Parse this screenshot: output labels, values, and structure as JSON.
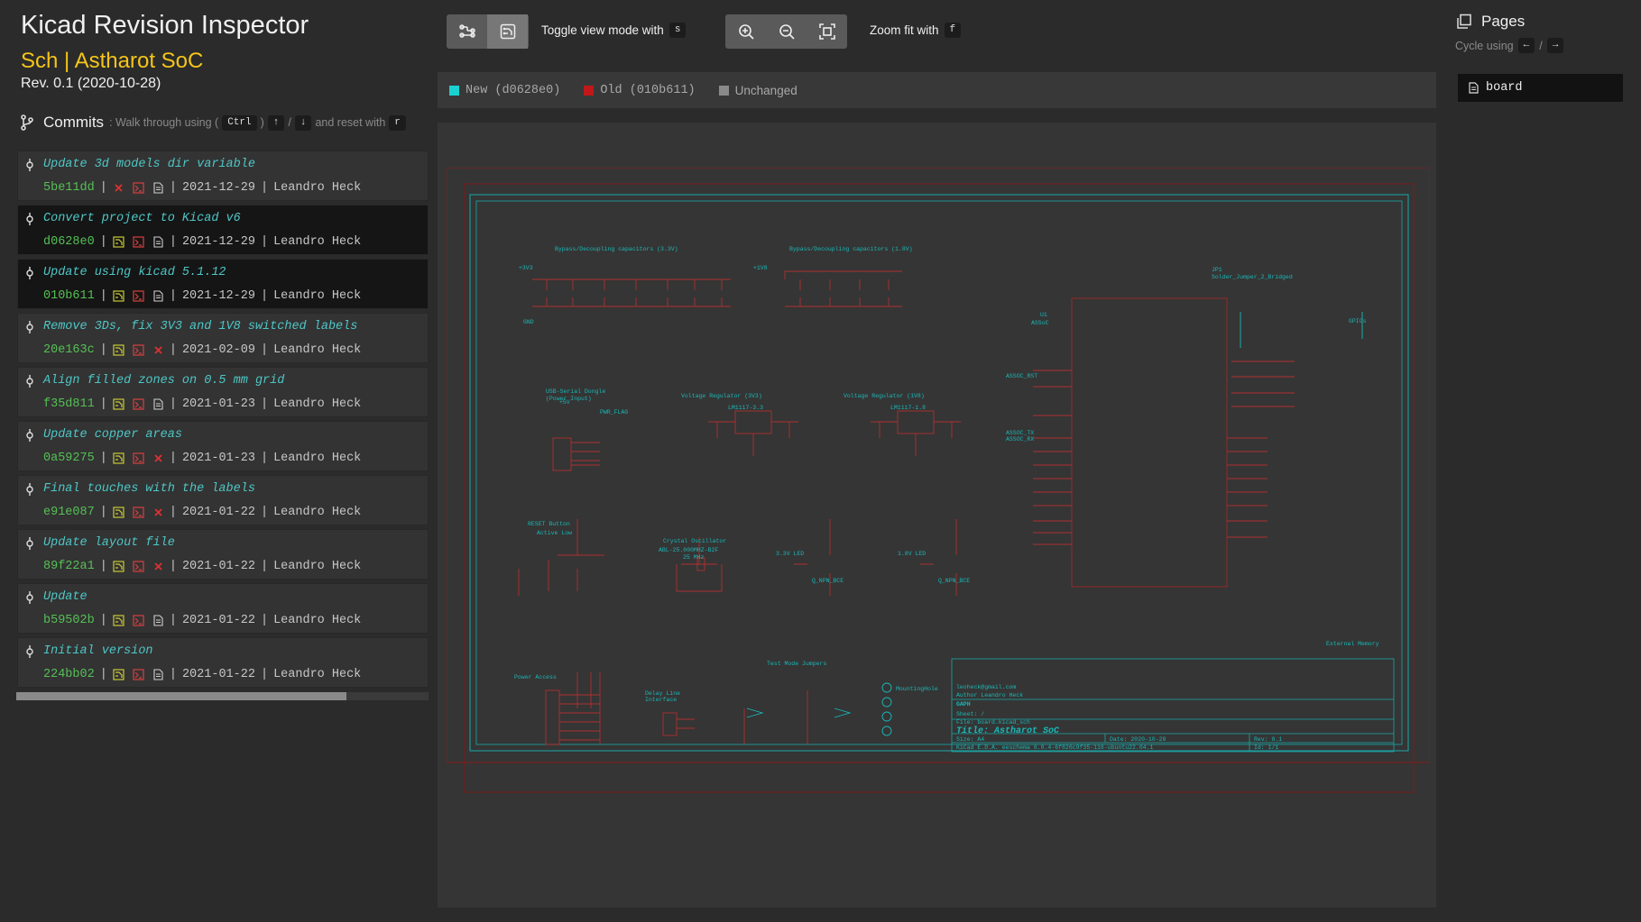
{
  "app": {
    "title": "Kicad Revision Inspector",
    "project": "Sch | Astharot SoC",
    "revision": "Rev. 0.1 (2020-10-28)"
  },
  "commits": {
    "title": "Commits",
    "hint_prefix": ": Walk through using (",
    "hint_key_ctrl": "Ctrl",
    "hint_paren": ")",
    "hint_key_up": "↑",
    "hint_slash": "/",
    "hint_key_down": "↓",
    "hint_reset": "and reset with",
    "hint_key_reset": "r",
    "items": [
      {
        "message": "Update 3d models dir variable",
        "hash": "5be11dd",
        "date": "2021-12-29",
        "author": "Leandro Heck",
        "icons": [
          "x",
          "sch",
          "doc"
        ],
        "selected": false
      },
      {
        "message": "Convert project to Kicad v6",
        "hash": "d0628e0",
        "date": "2021-12-29",
        "author": "Leandro Heck",
        "icons": [
          "pcb",
          "sch",
          "doc"
        ],
        "selected": true
      },
      {
        "message": "Update using kicad 5.1.12",
        "hash": "010b611",
        "date": "2021-12-29",
        "author": "Leandro Heck",
        "icons": [
          "pcb",
          "sch",
          "doc"
        ],
        "selected": true
      },
      {
        "message": "Remove 3Ds, fix 3V3 and 1V8 switched labels",
        "hash": "20e163c",
        "date": "2021-02-09",
        "author": "Leandro Heck",
        "icons": [
          "pcb",
          "sch",
          "x"
        ],
        "selected": false
      },
      {
        "message": "Align filled zones on 0.5 mm grid",
        "hash": "f35d811",
        "date": "2021-01-23",
        "author": "Leandro Heck",
        "icons": [
          "pcb",
          "sch",
          "doc"
        ],
        "selected": false
      },
      {
        "message": "Update copper areas",
        "hash": "0a59275",
        "date": "2021-01-23",
        "author": "Leandro Heck",
        "icons": [
          "pcb",
          "sch",
          "x"
        ],
        "selected": false
      },
      {
        "message": "Final touches with the labels",
        "hash": "e91e087",
        "date": "2021-01-22",
        "author": "Leandro Heck",
        "icons": [
          "pcb",
          "sch",
          "x"
        ],
        "selected": false
      },
      {
        "message": "Update layout file",
        "hash": "89f22a1",
        "date": "2021-01-22",
        "author": "Leandro Heck",
        "icons": [
          "pcb",
          "sch",
          "x"
        ],
        "selected": false
      },
      {
        "message": "Update",
        "hash": "b59502b",
        "date": "2021-01-22",
        "author": "Leandro Heck",
        "icons": [
          "pcb",
          "sch",
          "doc"
        ],
        "selected": false
      },
      {
        "message": "Initial version",
        "hash": "224bb02",
        "date": "2021-01-22",
        "author": "Leandro Heck",
        "icons": [
          "pcb",
          "sch",
          "doc"
        ],
        "selected": false
      }
    ],
    "scroll_fraction": 0.8
  },
  "toolbar": {
    "toggle_label": "Toggle view mode with",
    "toggle_key": "s",
    "zoom_label": "Zoom fit with",
    "zoom_key": "f"
  },
  "legend": {
    "new_label": "New (d0628e0)",
    "old_label": "Old (010b611)",
    "unchanged_label": "Unchanged",
    "new_color": "#1ad1d1",
    "old_color": "#c01818",
    "unchanged_color": "#8a8a8a"
  },
  "pages": {
    "title": "Pages",
    "cycle_label": "Cycle using",
    "key_left": "←",
    "slash": "/",
    "key_right": "→",
    "items": [
      "board"
    ]
  },
  "schematic": {
    "title_block": {
      "email": "leoheck@gmail.com",
      "author": "Author Leandro Heck",
      "org": "GAPH",
      "sheet": "Sheet: /",
      "file": "File: board.kicad_sch",
      "title": "Title: Astharot SoC",
      "size": "Size: A4",
      "date": "Date: 2020-10-28",
      "kicad": "KiCad E.D.A.  eeschema 6.0.4-6f826c9f35-116-ubuntu22.04.1",
      "rev": "Rev: 0.1",
      "id": "Id: 1/1"
    },
    "labels": {
      "bypass_3v3": "Bypass/Decoupling capacitors (3.3V)",
      "bypass_1v8": "Bypass/Decoupling capacitors (1.8V)",
      "usb_serial": "USB-Serial Dongle",
      "usb_power": "(Power Input)",
      "vreg_3v3": "Voltage Regulator (3V3)",
      "vreg_1v8": "Voltage Regulator (1V8)",
      "reset": "RESET Button",
      "reset_sub": "Active Low",
      "crystal": "Crystal Oscillator",
      "crystal_sub": "ABL-25.000MHZ-B2F",
      "led_3v3": "3.3V LED",
      "led_1v8": "1.8V LED",
      "gpios": "GPIOs",
      "ext_mem": "External Memory",
      "power_access": "Power Access",
      "delay_line": "Delay Line",
      "delay_line_sub": "Interface",
      "test_jumpers": "Test Mode Jumpers",
      "u1": "U1",
      "u1_val": "ASSoC",
      "jp1": "JP1",
      "jp1_val": "Solder_Jumper_2_Bridged",
      "u3_val": "LM1117-3.3",
      "u2_val": "LM1117-1.8",
      "y1_val": "25 MHz",
      "pwr_flag": "PWR_FLAG",
      "gnd": "GND",
      "v3v3": "+3V3",
      "v1v8": "+1V8",
      "v5v": "+5V",
      "assoc_rst": "ASSOC_RST",
      "assoc_rx": "ASSOC_RX",
      "assoc_tx": "ASSOC_TX",
      "q1": "Q_NPN_BCE",
      "q2": "Q_NPN_BCE",
      "mounting": "MountingHole"
    }
  }
}
